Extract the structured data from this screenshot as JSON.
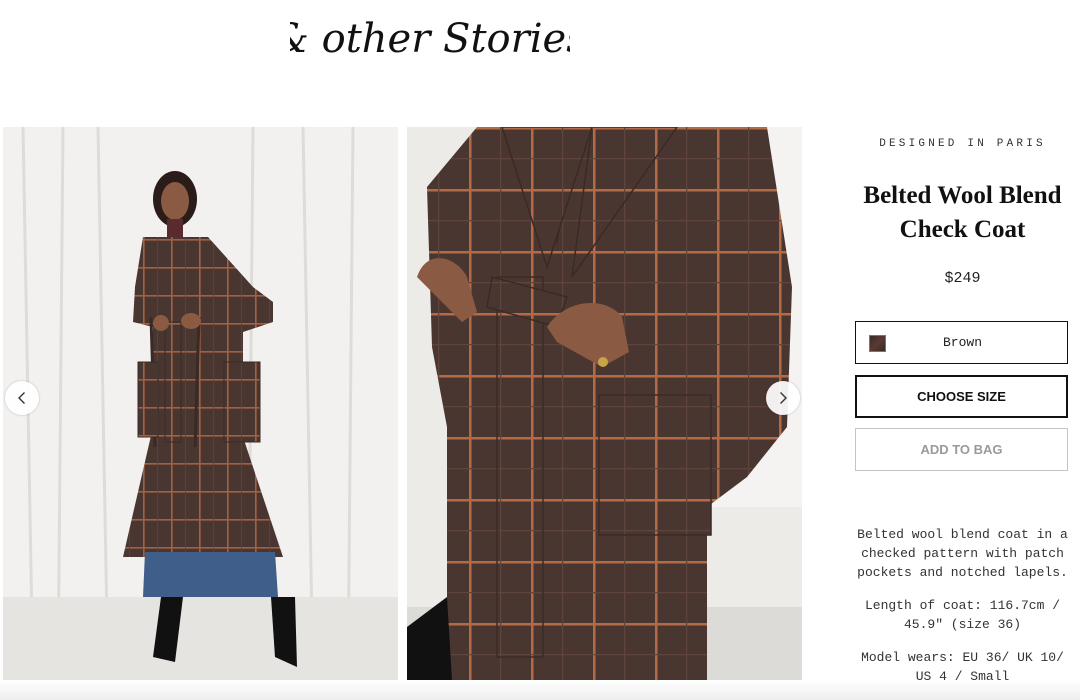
{
  "brand": {
    "logo_text": "& other Stories"
  },
  "gallery": {
    "photos": [
      {
        "alt": "Model wearing the belted check coat, full length"
      },
      {
        "alt": "Close-up of the belted check coat"
      }
    ],
    "prev_label": "Previous image",
    "next_label": "Next image"
  },
  "product": {
    "designed": "DESIGNED IN PARIS",
    "title_line1": "Belted Wool Blend",
    "title_line2": "Check Coat",
    "price": "$249",
    "color": "Brown",
    "choose_size": "CHOOSE SIZE",
    "add_to_bag": "ADD TO BAG",
    "description": "Belted wool blend coat in a checked pattern with patch pockets and notched lapels.",
    "length": "Length of coat: 116.7cm / 45.9\" (size 36)",
    "model_wears": "Model wears: EU 36/ UK 10/ US 4 / Small"
  },
  "colors": {
    "coat_base": "#4a3631",
    "coat_dark": "#3a2a26",
    "check_line": "#b46a44",
    "jeans": "#3f5f8a",
    "text": "#111111"
  }
}
